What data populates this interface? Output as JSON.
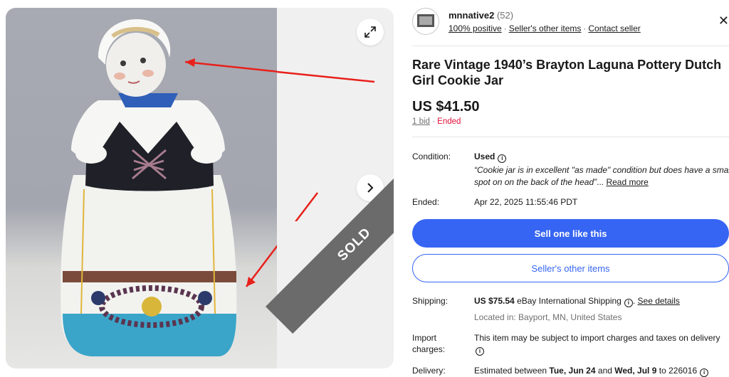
{
  "gallery": {
    "expand_icon": "expand-arrows-icon",
    "next_icon": "chevron-right-icon",
    "sold_label": "SOLD"
  },
  "seller": {
    "name": "mnnative2",
    "feedback_count": "(52)",
    "positive": "100% positive",
    "other_items_link": "Seller's other items",
    "contact_link": "Contact seller",
    "close_icon": "close-icon"
  },
  "listing": {
    "title": "Rare Vintage 1940’s Brayton Laguna Pottery Dutch Girl Cookie Jar",
    "price": "US $41.50",
    "bids": "1 bid",
    "status": "Ended"
  },
  "details": {
    "condition_label": "Condition:",
    "condition_value": "Used",
    "condition_quote_line1": "“Cookie jar is in excellent \"as made\" condition but does have a small",
    "condition_quote_line2": "spot on on the back of the head”",
    "read_more": "Read more",
    "ended_label": "Ended:",
    "ended_value": "Apr 22, 2025 11:55:46 PDT"
  },
  "actions": {
    "sell_one": "Sell one like this",
    "seller_other_items": "Seller's other items"
  },
  "shipping": {
    "label": "Shipping:",
    "cost": "US $75.54",
    "method": "eBay International Shipping",
    "see_details": "See details",
    "location": "Located in: Bayport, MN, United States"
  },
  "import": {
    "label_line1": "Import",
    "label_line2": "charges:",
    "text": "This item may be subject to import charges and taxes on delivery"
  },
  "delivery": {
    "label": "Delivery:",
    "prefix": "Estimated between",
    "start": "Tue, Jun 24",
    "and": "and",
    "end": "Wed, Jul 9",
    "to": "to 226016"
  },
  "colors": {
    "primary_blue": "#3665f3",
    "ended_red": "#e0103a",
    "sold_ribbon": "#6b6b6b",
    "arrow_red": "#e8201b"
  }
}
